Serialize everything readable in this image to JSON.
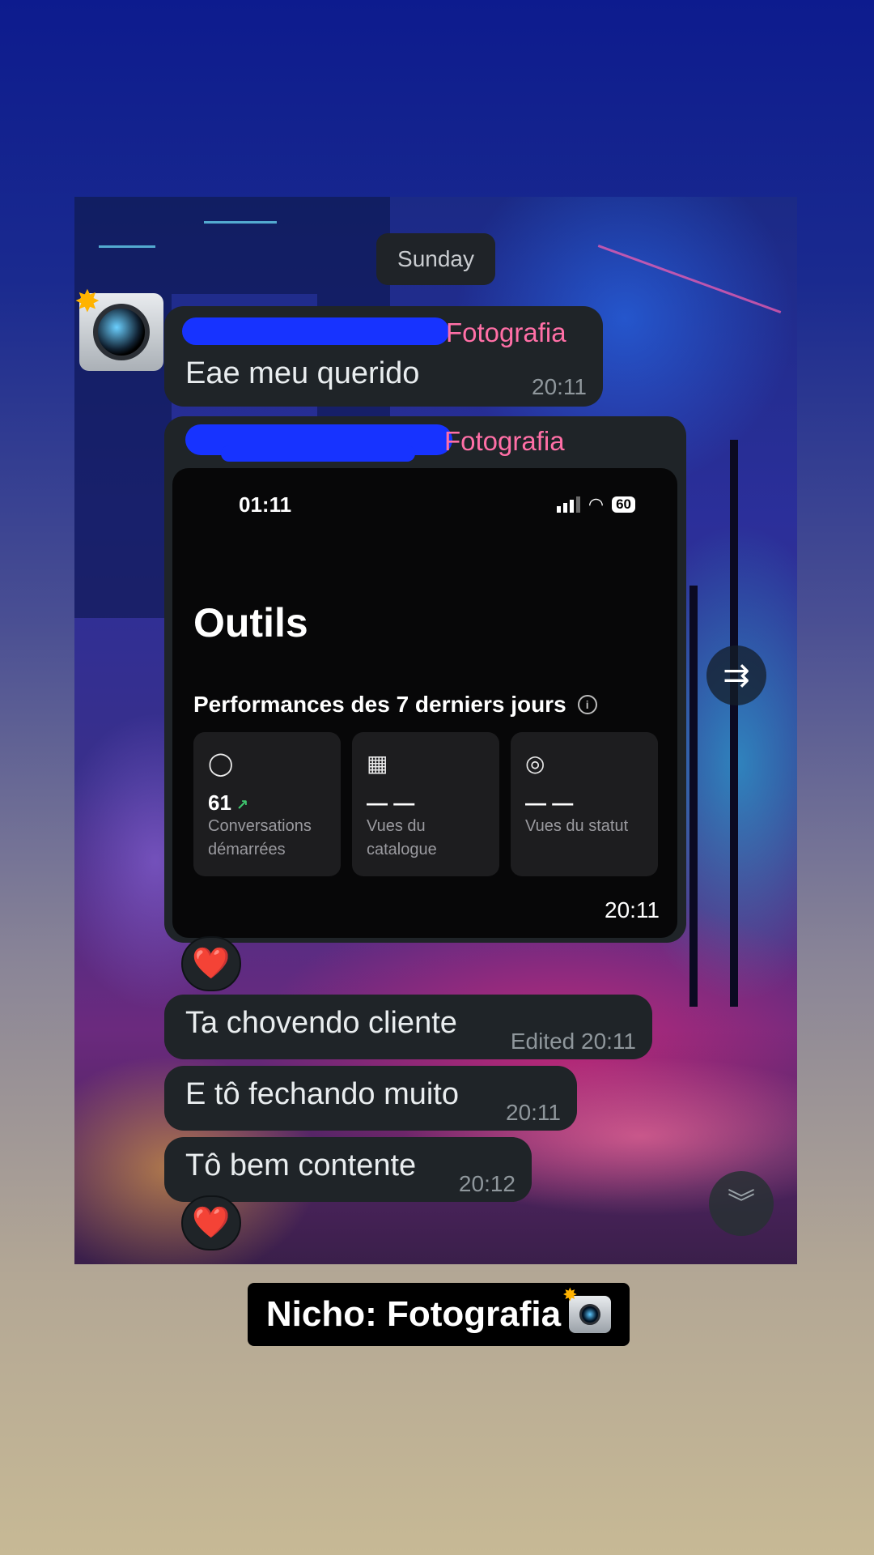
{
  "day_separator": "Sunday",
  "messages": [
    {
      "sender_suffix": "Fotografia",
      "text": "Eae meu querido",
      "time": "20:11"
    },
    {
      "sender_suffix": "Fotografia",
      "time": "20:11"
    },
    {
      "text": "Ta chovendo cliente",
      "time": "Edited 20:11"
    },
    {
      "text": "E tô fechando muito",
      "time": "20:11"
    },
    {
      "text": "Tô bem contente",
      "time": "20:12"
    }
  ],
  "embedded_screenshot": {
    "clock": "01:11",
    "battery": "60",
    "title": "Outils",
    "section": "Performances des 7 derniers jours",
    "cards": [
      {
        "icon": "chat-bubble-icon",
        "value": "61",
        "label": "Conversations démarrées"
      },
      {
        "icon": "grid-icon",
        "value": "— —",
        "label": "Vues du catalogue"
      },
      {
        "icon": "status-ring-icon",
        "value": "— —",
        "label": "Vues du statut"
      }
    ]
  },
  "reactions": [
    "❤️",
    "❤️"
  ],
  "caption": "Nicho: Fotografia",
  "colors": {
    "sender": "#ff6fa6",
    "bubble": "#1f2428",
    "redaction": "#1733ff"
  }
}
